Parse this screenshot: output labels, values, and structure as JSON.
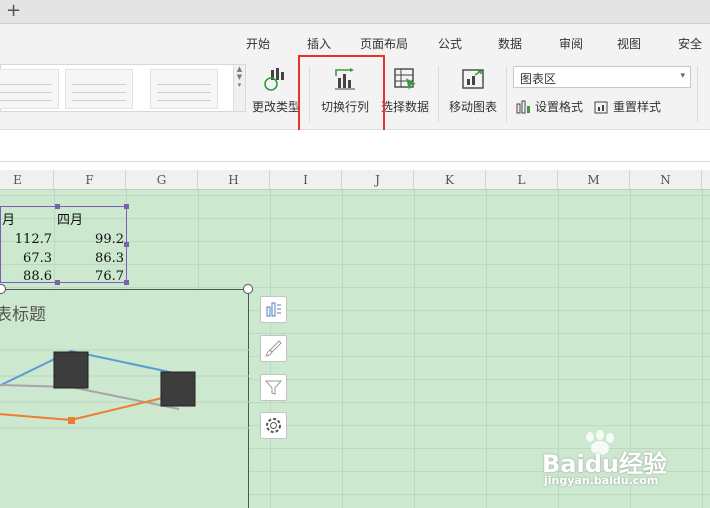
{
  "menu": [
    "开始",
    "插入",
    "页面布局",
    "公式",
    "数据",
    "审阅",
    "视图",
    "安全"
  ],
  "ribbon": {
    "change_type": "更改类型",
    "switch_row_col": "切换行列",
    "select_data": "选择数据",
    "move_chart": "移动图表",
    "chart_area": "图表区",
    "set_format": "设置格式",
    "reset_style": "重置样式"
  },
  "columns": [
    "E",
    "F",
    "G",
    "H",
    "I",
    "J",
    "K",
    "L",
    "M",
    "N"
  ],
  "table": {
    "headers": [
      "月",
      "四月"
    ],
    "rows": [
      [
        "112.7",
        "99.2"
      ],
      [
        "67.3",
        "86.3"
      ],
      [
        "88.6",
        "76.7"
      ]
    ]
  },
  "chart": {
    "title": "表标题",
    "accent": "#5b9bd5",
    "orange": "#ed7d31",
    "gray": "#a5a5a5"
  },
  "watermark": {
    "brand": "Baidu经验",
    "url": "jingyan.baidu.com"
  }
}
